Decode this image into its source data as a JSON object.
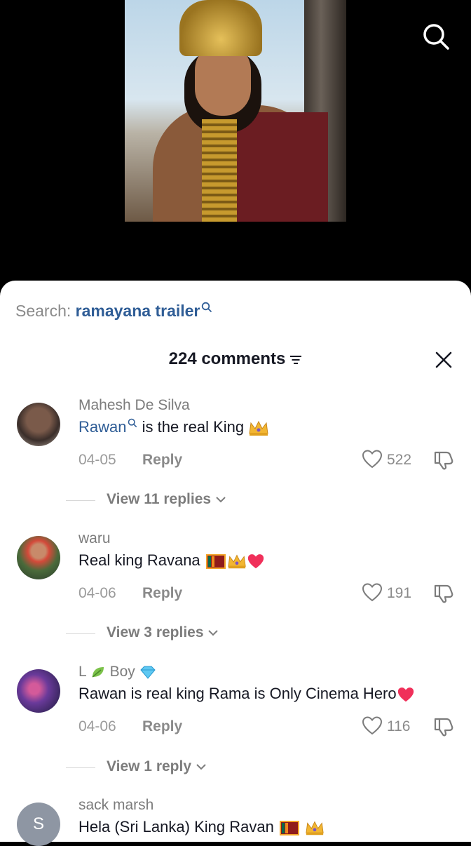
{
  "search": {
    "prefix": "Search:",
    "query": "ramayana trailer"
  },
  "header": {
    "count_text": "224 comments"
  },
  "comments": [
    {
      "user": "Mahesh De Silva",
      "tag": "Rawan",
      "text": " is the real King",
      "date": "04-05",
      "reply_label": "Reply",
      "likes": "522",
      "view_replies": "View 11 replies"
    },
    {
      "user": "waru",
      "text": "Real king Ravana",
      "date": "04-06",
      "reply_label": "Reply",
      "likes": "191",
      "view_replies": "View 3 replies"
    },
    {
      "user_a": "L",
      "user_b": "Boy",
      "text": "Rawan is real king Rama is Only Cinema Hero",
      "date": "04-06",
      "reply_label": "Reply",
      "likes": "116",
      "view_replies": "View 1 reply"
    },
    {
      "user": "sack marsh",
      "avatar_letter": "S",
      "text": "Hela (Sri Lanka) King Ravan"
    }
  ],
  "icons": {
    "search": "search-icon",
    "sort": "sort-icon",
    "close": "close-icon",
    "like": "heart-outline-icon",
    "dislike": "thumbs-down-icon",
    "chevron": "chevron-down-icon"
  }
}
